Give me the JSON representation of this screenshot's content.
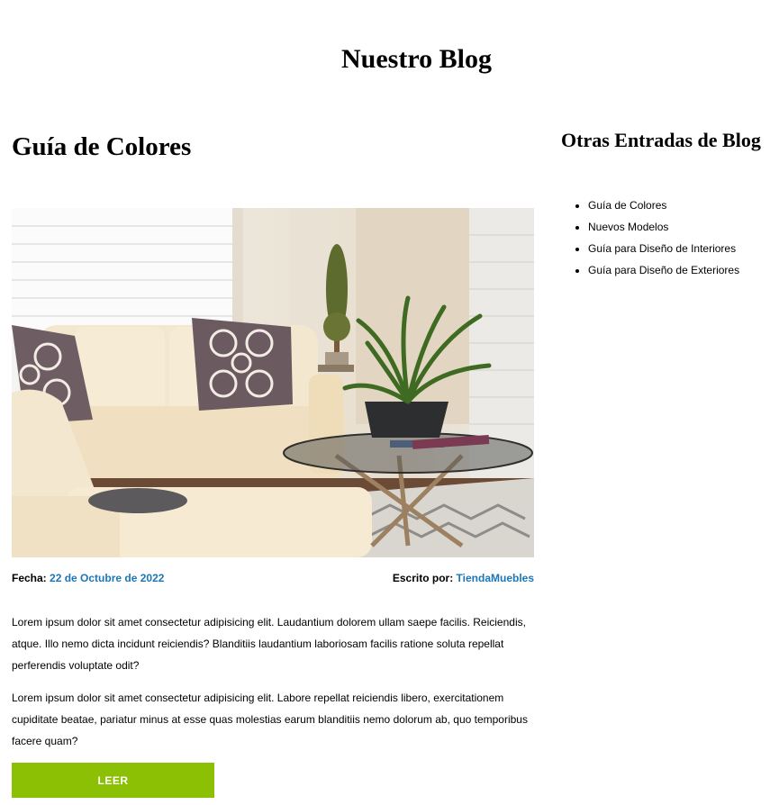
{
  "header": {
    "title": "Nuestro Blog"
  },
  "post": {
    "title": "Guía de Colores",
    "date_label": "Fecha:",
    "date_value": "22 de Octubre de 2022",
    "author_label": "Escrito por:",
    "author_value": "TiendaMuebles",
    "paragraphs": [
      "Lorem ipsum dolor sit amet consectetur adipisicing elit. Laudantium dolorem ullam saepe facilis. Reiciendis, atque. Illo nemo dicta incidunt reiciendis? Blanditiis laudantium laboriosam facilis ratione soluta repellat perferendis voluptate odit?",
      "Lorem ipsum dolor sit amet consectetur adipisicing elit. Labore repellat reiciendis libero, exercitationem cupiditate beatae, pariatur minus at esse quas molestias earum blanditiis nemo dolorum ab, quo temporibus facere quam?"
    ],
    "button_label": "LEER"
  },
  "sidebar": {
    "title": "Otras Entradas de Blog",
    "items": [
      {
        "label": "Guía de Colores"
      },
      {
        "label": "Nuevos Modelos"
      },
      {
        "label": "Guía para Diseño de Interiores"
      },
      {
        "label": "Guía para Diseño de Exteriores"
      }
    ]
  },
  "colors": {
    "accent_link": "#1d76b5",
    "button_bg": "#8bc004"
  }
}
